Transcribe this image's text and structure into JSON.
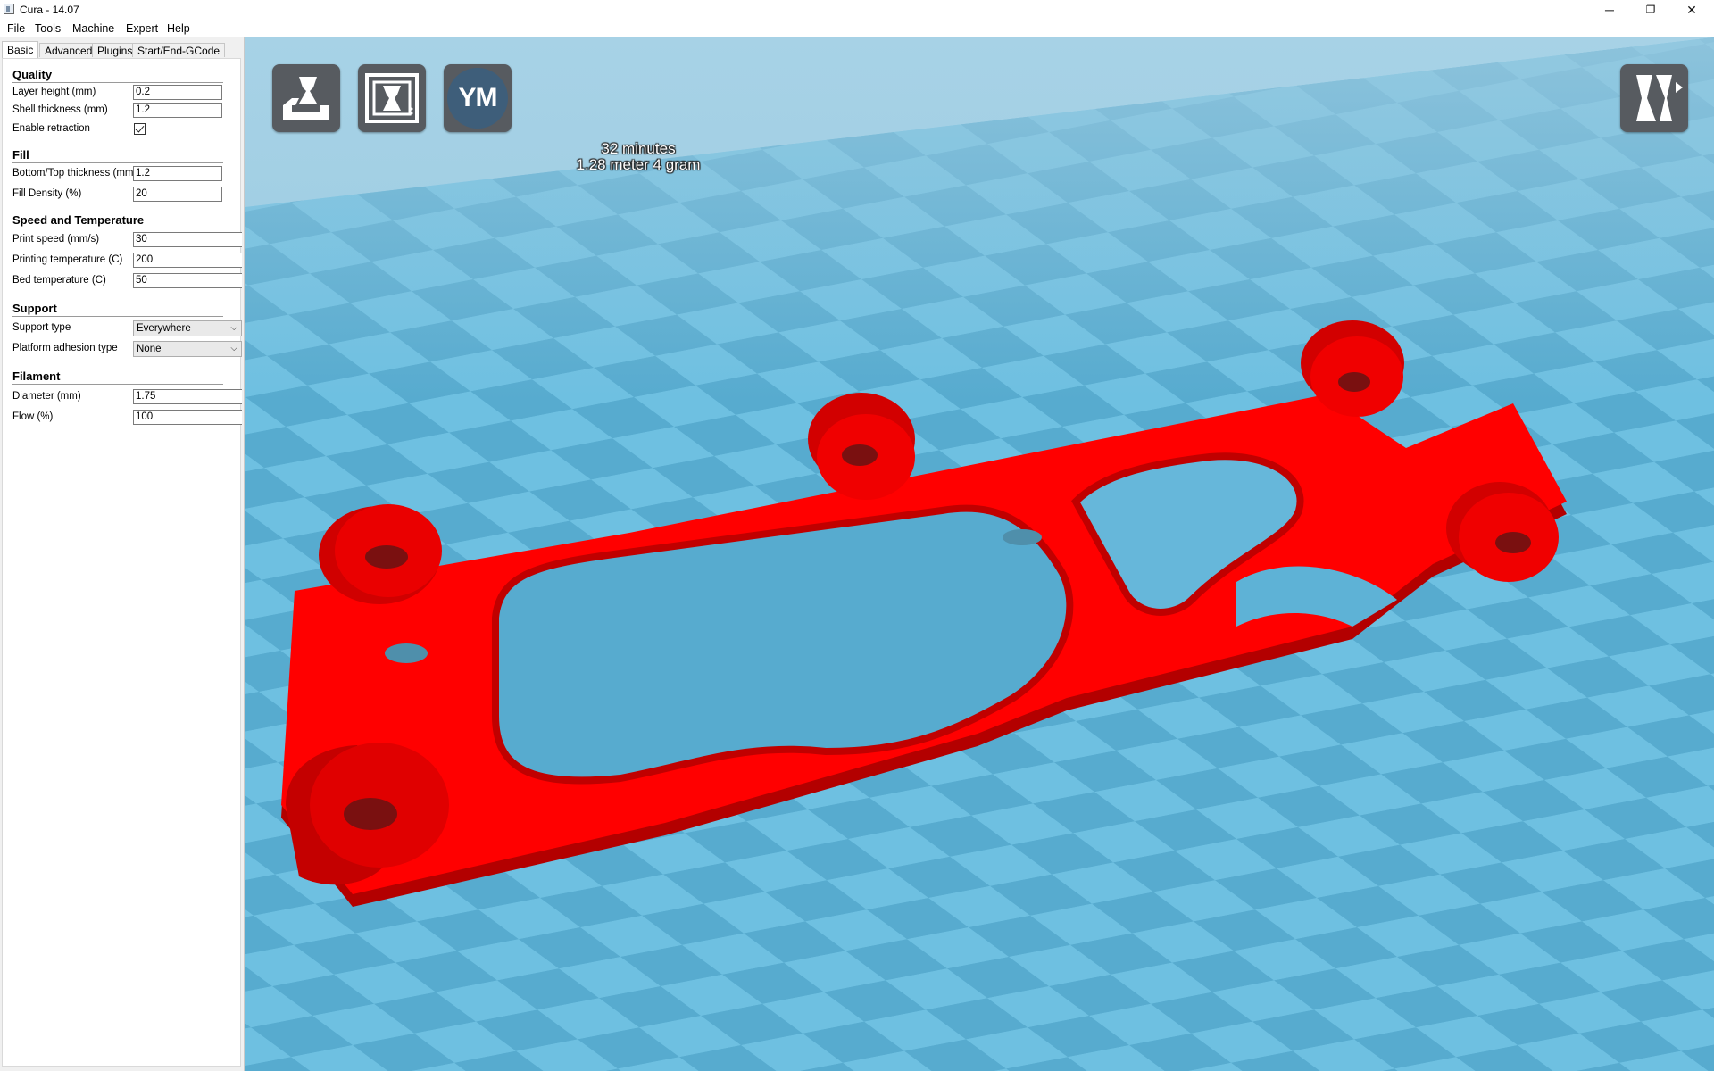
{
  "window": {
    "title": "Cura - 14.07",
    "minimize": "─",
    "restore": "❐",
    "close": "✕"
  },
  "menu": [
    "File",
    "Tools",
    "Machine",
    "Expert",
    "Help"
  ],
  "tabs": [
    "Basic",
    "Advanced",
    "Plugins",
    "Start/End-GCode"
  ],
  "settings": {
    "quality": {
      "title": "Quality",
      "layer_height_label": "Layer height (mm)",
      "layer_height": "0.2",
      "shell_thickness_label": "Shell thickness (mm)",
      "shell_thickness": "1.2",
      "retraction_label": "Enable retraction",
      "retraction": true
    },
    "fill": {
      "title": "Fill",
      "bottom_top_label": "Bottom/Top thickness (mm)",
      "bottom_top": "1.2",
      "density_label": "Fill Density (%)",
      "density": "20"
    },
    "speed": {
      "title": "Speed and Temperature",
      "print_speed_label": "Print speed (mm/s)",
      "print_speed": "30",
      "print_temp_label": "Printing temperature (C)",
      "print_temp": "200",
      "bed_temp_label": "Bed temperature (C)",
      "bed_temp": "50"
    },
    "support": {
      "title": "Support",
      "support_type_label": "Support type",
      "support_type": "Everywhere",
      "adhesion_label": "Platform adhesion type",
      "adhesion": "None"
    },
    "filament": {
      "title": "Filament",
      "diameter_label": "Diameter (mm)",
      "diameter": "1.75",
      "flow_label": "Flow (%)",
      "flow": "100"
    }
  },
  "viewport": {
    "ym_label": "YM",
    "estimate_time": "32 minutes",
    "estimate_material": "1.28 meter 4 gram",
    "model_color": "#ff0000",
    "floor_color_light": "#6fc0e0",
    "floor_color_dark": "#4aa3c8",
    "icons": [
      "load-model-icon",
      "print-to-file-icon",
      "youmagine-icon",
      "view-mode-icon"
    ]
  }
}
